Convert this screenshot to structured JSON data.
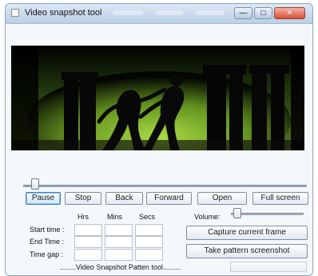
{
  "window": {
    "title": "Video snapshot tool",
    "minimize_glyph": "—",
    "maximize_glyph": "□",
    "close_glyph": "✕"
  },
  "video": {
    "background_color": "#000000",
    "stage_color": "#8fbe2a",
    "silhouette_color": "#0a0a0a"
  },
  "playback": {
    "position": 0.03
  },
  "controls": {
    "pause": "Pause",
    "stop": "Stop",
    "back": "Back",
    "forward": "Forward",
    "open": "Open",
    "full_screen": "Full screen"
  },
  "time_labels": {
    "hrs": "Hrs",
    "mins": "Mins",
    "secs": "Secs",
    "start_time": "Start time :",
    "end_time": "End Time :",
    "time_gap": "Time gap :"
  },
  "volume": {
    "label": "Volume:",
    "level": 0.04
  },
  "actions": {
    "capture_current_frame": "Capture current frame",
    "take_pattern_screenshot": "Take pattern screenshot"
  },
  "footer": {
    "status": "........Video Snapshot Patten tool.........",
    "progress": 0
  }
}
